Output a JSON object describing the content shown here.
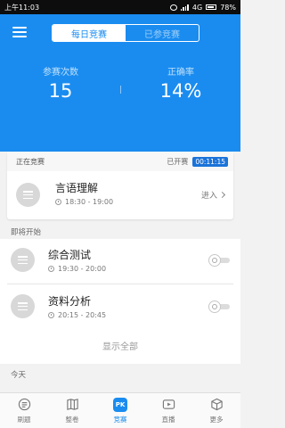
{
  "status_bar": {
    "time": "上午11:03",
    "network": "4G",
    "battery": "78%"
  },
  "header": {
    "tabs": [
      {
        "label": "每日竞赛",
        "active": true
      },
      {
        "label": "已参竞赛",
        "active": false
      }
    ],
    "stats": [
      {
        "label": "参赛次数",
        "value": "15"
      },
      {
        "label": "正确率",
        "value": "14%"
      }
    ]
  },
  "current": {
    "section_title": "正在竞赛",
    "started_label": "已开赛",
    "timer": "00:11:15",
    "item": {
      "title": "言语理解",
      "time": "18:30 - 19:00",
      "action": "进入"
    }
  },
  "upcoming": {
    "section_title": "即将开始",
    "items": [
      {
        "title": "综合测试",
        "time": "19:30 - 20:00"
      },
      {
        "title": "资料分析",
        "time": "20:15 - 20:45"
      }
    ],
    "show_all": "显示全部"
  },
  "today": {
    "section_title": "今天"
  },
  "tabbar": {
    "items": [
      {
        "label": "刷题",
        "icon": "list-icon"
      },
      {
        "label": "整卷",
        "icon": "map-icon"
      },
      {
        "label": "竞赛",
        "icon": "pk-icon",
        "badge": "PK",
        "active": true
      },
      {
        "label": "直播",
        "icon": "play-icon"
      },
      {
        "label": "更多",
        "icon": "box-icon"
      }
    ]
  },
  "colors": {
    "primary": "#1a8cf0",
    "timer_bg": "#1a73d9",
    "background": "#f2f2f2"
  }
}
